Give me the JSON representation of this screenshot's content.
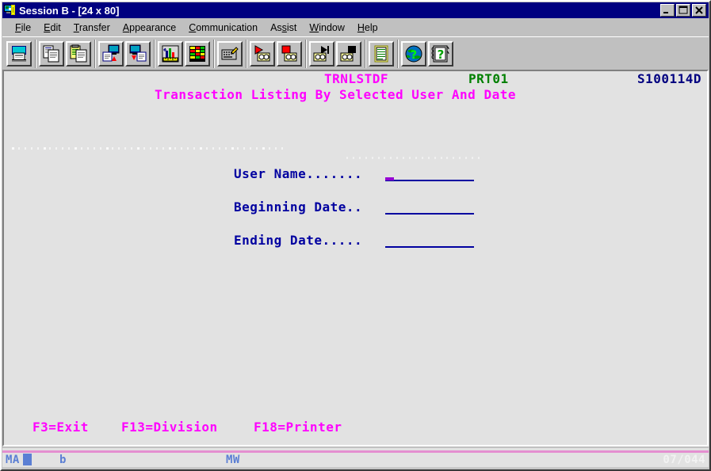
{
  "window": {
    "title": "Session B - [24 x 80]",
    "icon": "session-monitor-icon",
    "buttons": {
      "minimize": "_",
      "maximize": "□",
      "close": "×"
    }
  },
  "menubar": {
    "items": [
      {
        "label": "File",
        "mnemonic": "F",
        "name": "menu-file"
      },
      {
        "label": "Edit",
        "mnemonic": "E",
        "name": "menu-edit"
      },
      {
        "label": "Transfer",
        "mnemonic": "T",
        "name": "menu-transfer"
      },
      {
        "label": "Appearance",
        "mnemonic": "A",
        "name": "menu-appearance"
      },
      {
        "label": "Communication",
        "mnemonic": "C",
        "name": "menu-communication"
      },
      {
        "label": "Assist",
        "mnemonic": "s",
        "name": "menu-assist"
      },
      {
        "label": "Window",
        "mnemonic": "W",
        "name": "menu-window"
      },
      {
        "label": "Help",
        "mnemonic": "H",
        "name": "menu-help"
      }
    ]
  },
  "toolbar": {
    "groups": [
      {
        "buttons": [
          {
            "icon": "print-icon",
            "name": "toolbar-print"
          }
        ]
      },
      {
        "buttons": [
          {
            "icon": "copy-icon",
            "name": "toolbar-copy"
          },
          {
            "icon": "paste-icon",
            "name": "toolbar-paste"
          }
        ]
      },
      {
        "buttons": [
          {
            "icon": "send-to-host-icon",
            "name": "toolbar-send"
          },
          {
            "icon": "receive-from-host-icon",
            "name": "toolbar-receive"
          }
        ]
      },
      {
        "buttons": [
          {
            "icon": "chart-wizard-icon",
            "name": "toolbar-chart-wizard"
          },
          {
            "icon": "spreadsheet-icon",
            "name": "toolbar-spreadsheet"
          }
        ]
      },
      {
        "buttons": [
          {
            "icon": "keyboard-setup-icon",
            "name": "toolbar-keyboard-setup"
          }
        ]
      },
      {
        "buttons": [
          {
            "icon": "record-macro-icon",
            "name": "toolbar-record-macro"
          },
          {
            "icon": "stop-record-icon",
            "name": "toolbar-stop-record"
          }
        ]
      },
      {
        "buttons": [
          {
            "icon": "play-macro-icon",
            "name": "toolbar-play-macro"
          },
          {
            "icon": "stop-macro-icon",
            "name": "toolbar-stop-macro"
          }
        ]
      },
      {
        "buttons": [
          {
            "icon": "clipboard-icon",
            "name": "toolbar-clipboard"
          }
        ]
      },
      {
        "buttons": [
          {
            "icon": "globe-help-icon",
            "name": "toolbar-web-help"
          },
          {
            "icon": "index-help-icon",
            "name": "toolbar-index-help"
          }
        ]
      }
    ]
  },
  "screen": {
    "program_id": "TRNLSTDF",
    "printer_id": "PRT01",
    "system_id": "S100114D",
    "title": "Transaction Listing By Selected User And Date",
    "fields": [
      {
        "label": "User Name.......",
        "value": "",
        "name": "user-name-field"
      },
      {
        "label": "Beginning Date..",
        "value": "",
        "name": "beginning-date-field"
      },
      {
        "label": "Ending Date.....",
        "value": "",
        "name": "ending-date-field"
      }
    ],
    "function_keys": "F3=Exit   F13=Division   F18=Printer",
    "function_key_list": [
      {
        "key": "F3",
        "label": "F3=Exit",
        "name": "fkey-exit"
      },
      {
        "key": "F13",
        "label": "F13=Division",
        "name": "fkey-division"
      },
      {
        "key": "F18",
        "label": "F18=Printer",
        "name": "fkey-printer"
      }
    ]
  },
  "status_bar": {
    "system_indicator": "MA",
    "input_indicator": "b",
    "mode_indicator": "MW",
    "cursor_position": "07/044"
  },
  "colors": {
    "titlebar": "#000080",
    "chrome": "#c0c0c0",
    "terminal_bg": "#e2e2e2",
    "text_pink": "#ff00ff",
    "text_green": "#008000",
    "text_blue": "#0000a0",
    "oia_line": "#e48fd0",
    "oia_text": "#5b7fd4",
    "cursor": "#9400d3"
  }
}
